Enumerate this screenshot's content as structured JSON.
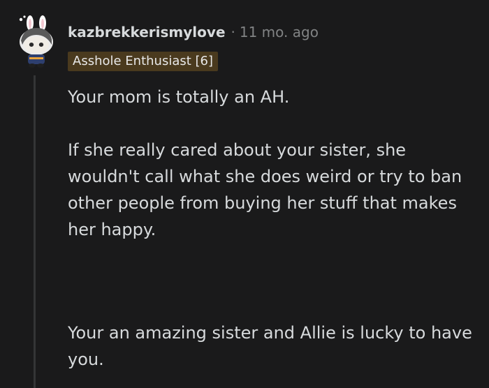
{
  "comment": {
    "username": "kazbrekkerismylove",
    "separator": "·",
    "timestamp": "11 mo. ago",
    "flair": "Asshole Enthusiast [6]",
    "paragraphs": [
      "Your mom is totally an AH.",
      "If she really cared about your sister, she wouldn't call what she does weird or try to ban other people from buying her stuff that makes her happy.",
      "Your an amazing sister and Allie is lucky to have you."
    ]
  },
  "colors": {
    "background": "#1a1a1b",
    "text": "#d7dadc",
    "meta": "#818384",
    "flair_bg": "#4a3a1e",
    "thread_line": "#343536"
  },
  "icons": {
    "avatar": "snoo-avatar-icon"
  }
}
